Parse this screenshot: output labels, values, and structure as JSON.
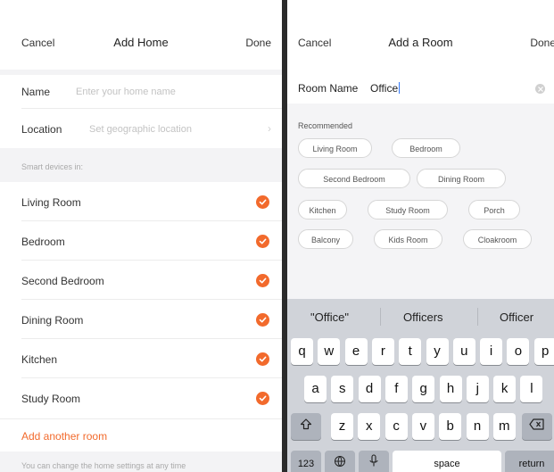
{
  "left": {
    "nav": {
      "cancel": "Cancel",
      "title": "Add Home",
      "done": "Done"
    },
    "name": {
      "label": "Name",
      "placeholder": "Enter your home name"
    },
    "location": {
      "label": "Location",
      "placeholder": "Set geographic location"
    },
    "section_label": "Smart devices in:",
    "rooms": [
      {
        "label": "Living Room",
        "checked": true
      },
      {
        "label": "Bedroom",
        "checked": true
      },
      {
        "label": "Second Bedroom",
        "checked": true
      },
      {
        "label": "Dining Room",
        "checked": true
      },
      {
        "label": "Kitchen",
        "checked": true
      },
      {
        "label": "Study Room",
        "checked": true
      }
    ],
    "add_room": "Add another room",
    "footer_note": "You can change the home settings at any time"
  },
  "right": {
    "nav": {
      "cancel": "Cancel",
      "title": "Add a Room",
      "done": "Done"
    },
    "room_name": {
      "label": "Room Name",
      "value": "Office"
    },
    "recommended_label": "Recommended",
    "chips": [
      "Living Room",
      "Bedroom",
      "Second Bedroom",
      "Dining Room",
      "Kitchen",
      "Study Room",
      "Porch",
      "Balcony",
      "Kids Room",
      "Cloakroom"
    ],
    "keyboard": {
      "suggestions": [
        "\"Office\"",
        "Officers",
        "Officer"
      ],
      "row1": [
        "q",
        "w",
        "e",
        "r",
        "t",
        "y",
        "u",
        "i",
        "o",
        "p"
      ],
      "row2": [
        "a",
        "s",
        "d",
        "f",
        "g",
        "h",
        "j",
        "k",
        "l"
      ],
      "row3": [
        "z",
        "x",
        "c",
        "v",
        "b",
        "n",
        "m"
      ],
      "numbers_key": "123",
      "space_key": "space",
      "return_key": "return"
    }
  },
  "colors": {
    "accent": "#f26a2c",
    "keyboard_bg": "#d0d3d9",
    "caret": "#3478f6"
  }
}
